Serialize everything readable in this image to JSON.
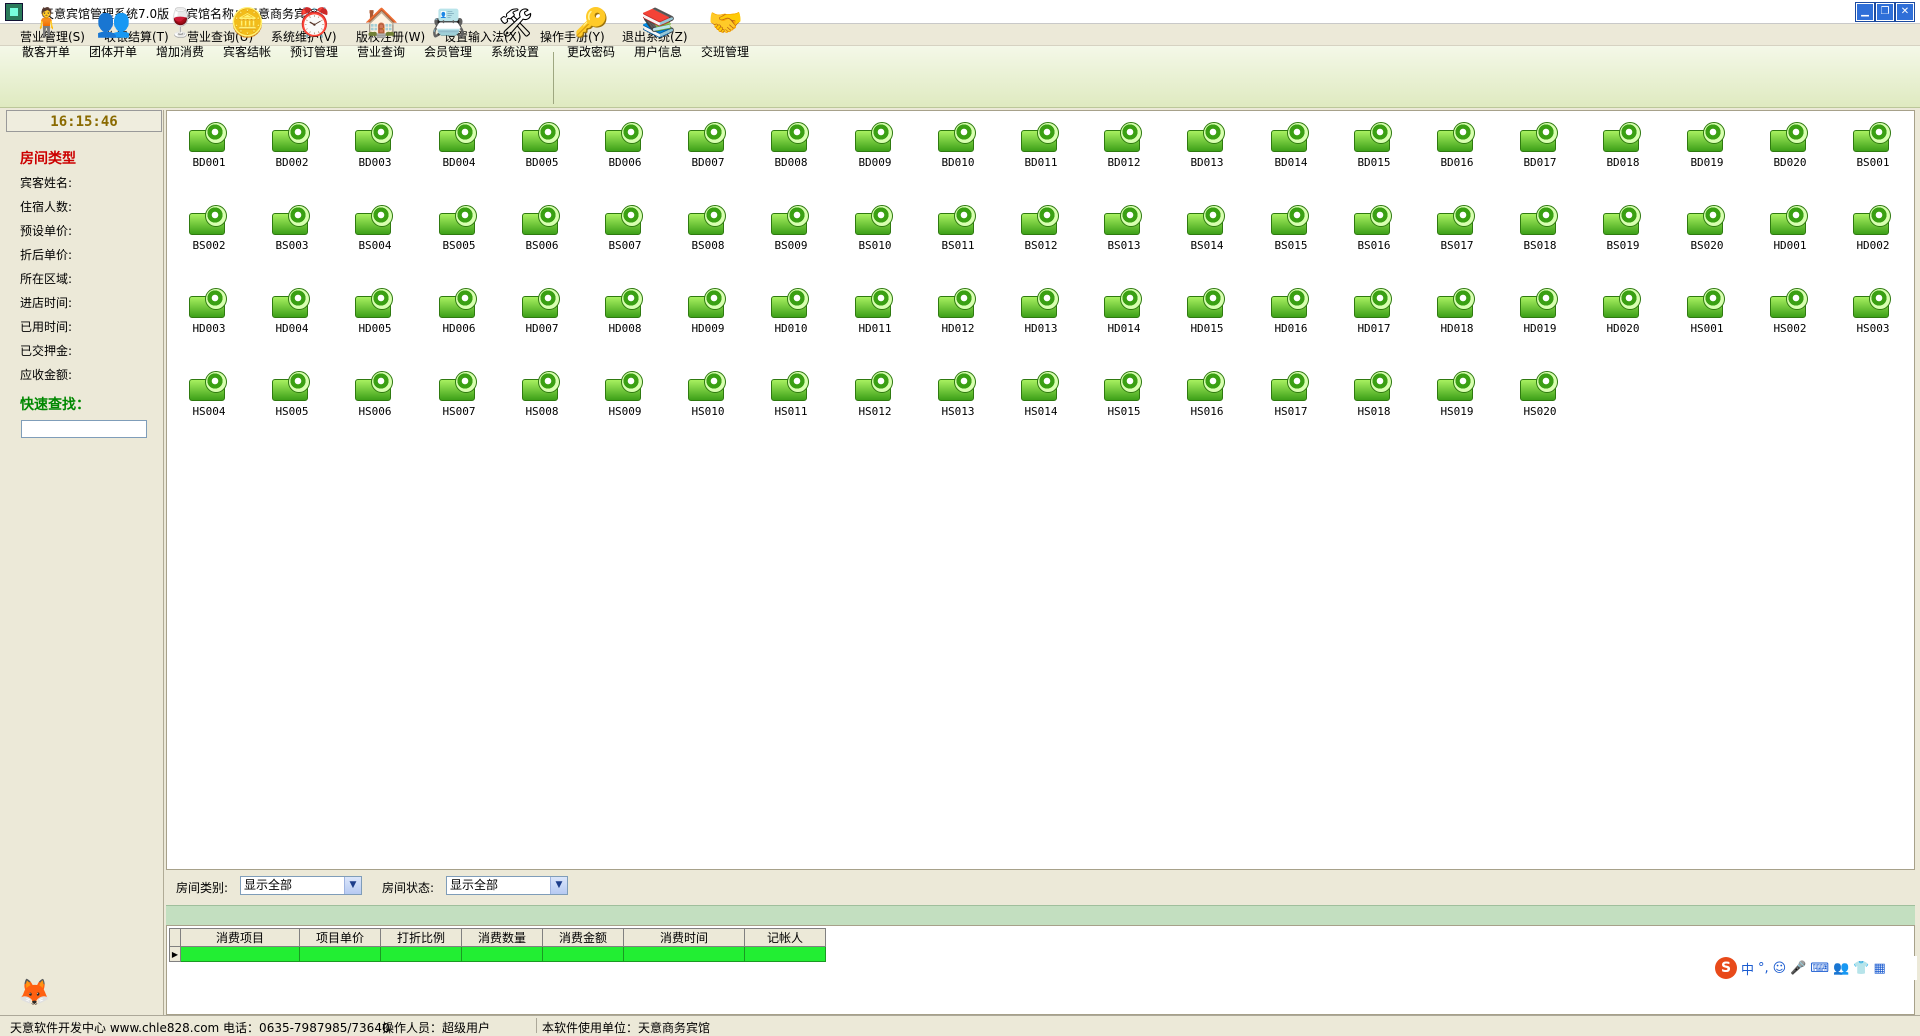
{
  "window": {
    "title": "天意宾馆管理系统7.0版",
    "hotel_label": "宾馆名称：天意商务宾馆",
    "controls": [
      "▁",
      "❐",
      "✕"
    ]
  },
  "menu": [
    "营业管理(S)",
    "收银结算(T)",
    "营业查询(U)",
    "系统维护(V)",
    "版权注册(W)",
    "设置输入法(X)",
    "操作手册(Y)",
    "退出系统(Z)"
  ],
  "toolbar": [
    {
      "label": "散客开单",
      "icon": "person-icon",
      "glyph": "🧍"
    },
    {
      "label": "团体开单",
      "icon": "group-icon",
      "glyph": "👥"
    },
    {
      "label": "增加消费",
      "icon": "wine-icon",
      "glyph": "🍷"
    },
    {
      "label": "宾客结帐",
      "icon": "coins-icon",
      "glyph": "🪙"
    },
    {
      "label": "预订管理",
      "icon": "alarm-clock-icon",
      "glyph": "⏰"
    },
    {
      "label": "营业查询",
      "icon": "search-house-icon",
      "glyph": "🏠"
    },
    {
      "label": "会员管理",
      "icon": "member-icon",
      "glyph": "📇"
    },
    {
      "label": "系统设置",
      "icon": "tools-icon",
      "glyph": "🛠"
    },
    {
      "label": "更改密码",
      "icon": "key-icon",
      "glyph": "🔑"
    },
    {
      "label": "用户信息",
      "icon": "books-icon",
      "glyph": "📚"
    },
    {
      "label": "交班管理",
      "icon": "handshake-icon",
      "glyph": "🤝"
    }
  ],
  "left_panel": {
    "clock": "16:15:46",
    "room_type_heading": "房间类型",
    "fields": [
      "宾客姓名:",
      "住宿人数:",
      "预设单价:",
      "折后单价:",
      "所在区域:",
      "进店时间:",
      "已用时间:",
      "已交押金:",
      "应收金额:"
    ],
    "quick_search_heading": "快速查找：",
    "quick_search_value": ""
  },
  "rooms": [
    "BD001",
    "BD002",
    "BD003",
    "BD004",
    "BD005",
    "BD006",
    "BD007",
    "BD008",
    "BD009",
    "BD010",
    "BD011",
    "BD012",
    "BD013",
    "BD014",
    "BD015",
    "BD016",
    "BD017",
    "BD018",
    "BD019",
    "BD020",
    "BS001",
    "BS002",
    "BS003",
    "BS004",
    "BS005",
    "BS006",
    "BS007",
    "BS008",
    "BS009",
    "BS010",
    "BS011",
    "BS012",
    "BS013",
    "BS014",
    "BS015",
    "BS016",
    "BS017",
    "BS018",
    "BS019",
    "BS020",
    "HD001",
    "HD002",
    "HD003",
    "HD004",
    "HD005",
    "HD006",
    "HD007",
    "HD008",
    "HD009",
    "HD010",
    "HD011",
    "HD012",
    "HD013",
    "HD014",
    "HD015",
    "HD016",
    "HD017",
    "HD018",
    "HD019",
    "HD020",
    "HS001",
    "HS002",
    "HS003",
    "HS004",
    "HS005",
    "HS006",
    "HS007",
    "HS008",
    "HS009",
    "HS010",
    "HS011",
    "HS012",
    "HS013",
    "HS014",
    "HS015",
    "HS016",
    "HS017",
    "HS018",
    "HS019",
    "HS020"
  ],
  "filters": {
    "room_category_label": "房间类别:",
    "room_category_value": "显示全部",
    "room_status_label": "房间状态:",
    "room_status_value": "显示全部"
  },
  "consume_table": {
    "columns": [
      "消费项目",
      "项目单价",
      "打折比例",
      "消费数量",
      "消费金额",
      "消费时间",
      "记帐人"
    ],
    "row_indicator": "▶"
  },
  "ime": [
    "中",
    "°,",
    "☺",
    "🎤",
    "⌨",
    "👥",
    "👕",
    "▦"
  ],
  "ime_logo": "S",
  "status": {
    "developer": "天意软件开发中心 www.chle828.com 电话：0635-7987985/73640",
    "operator": "操作人员：超级用户",
    "unit": "本软件使用单位：天意商务宾馆"
  },
  "colors": {
    "room_green": "#3da018",
    "clock_text": "#8a6a00",
    "heading_red": "#cc0000",
    "quick_green": "#008800",
    "row_green": "#22ee33"
  }
}
